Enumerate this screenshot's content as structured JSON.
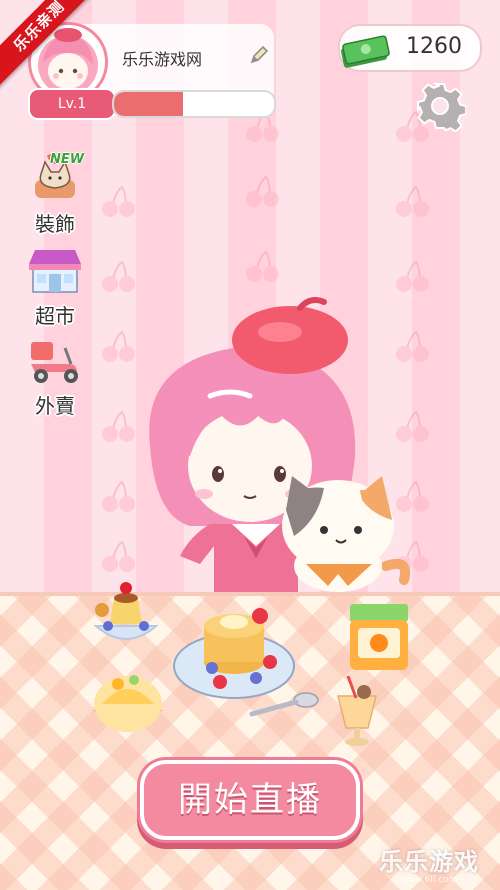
{
  "ribbon": {
    "text": "乐乐亲测"
  },
  "profile": {
    "name": "乐乐游戏网",
    "level": "Lv.1",
    "xp_progress": 0.43
  },
  "currency": {
    "icon": "money-stack-icon",
    "amount": "1260"
  },
  "settings": {
    "icon": "gear-icon"
  },
  "side_menu": {
    "new_badge": "NEW",
    "items": [
      {
        "label": "裝飾",
        "icon": "cat-decoration-icon"
      },
      {
        "label": "超市",
        "icon": "supermarket-icon"
      },
      {
        "label": "外賣",
        "icon": "delivery-scooter-icon"
      }
    ]
  },
  "start_button": {
    "label": "開始直播"
  },
  "watermark": {
    "title": "乐乐游戏",
    "url": "www.6ll.com"
  },
  "colors": {
    "accent": "#f38aa0",
    "bar_fill": "#ec6d6d",
    "level_badge": "#e85a78"
  }
}
